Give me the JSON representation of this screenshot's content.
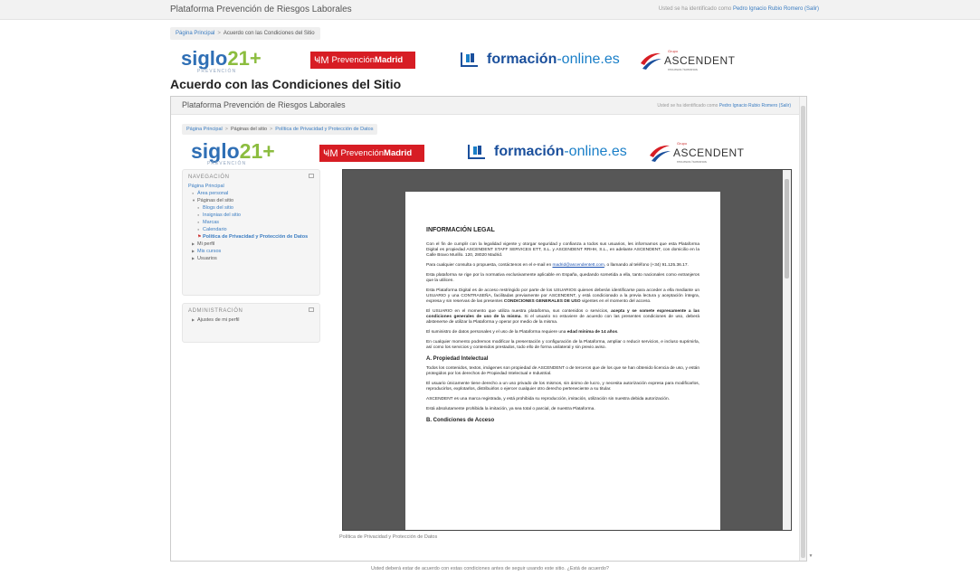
{
  "topbar": {
    "site_title": "Plataforma Prevención de Riesgos Laborales",
    "login_prefix": "Usted se ha identificado como ",
    "user_name": "Pedro Ignacio Rubio Romero",
    "logout": " (Salir)"
  },
  "breadcrumb": {
    "home": "Página Principal",
    "current": "Acuerdo con las Condiciones del Sitio"
  },
  "logos": {
    "siglo": {
      "a": "siglo",
      "b": "21",
      "plus": "+",
      "sub": "PREVENCIÓN"
    },
    "pmadrid": {
      "mark": "ҸМ",
      "a": "Prevención ",
      "b": "Madrid"
    },
    "formacion": {
      "a": "formación",
      "b": "-online.es"
    },
    "ascendent": {
      "grupo": "Grupo",
      "name": "ASCENDENT",
      "sub": "recursos humanos"
    }
  },
  "page_heading": "Acuerdo con las Condiciones del Sitio",
  "embedded": {
    "site_title": "Plataforma Prevención de Riesgos Laborales",
    "login_prefix": "Usted se ha identificado como ",
    "user_name": "Pedro Ignacio Rubio Romero",
    "logout": " (Salir)",
    "breadcrumb": {
      "home": "Página Principal",
      "pages": "Páginas del sitio",
      "current": "Política de Privacidad y Protección de Datos"
    },
    "navigation": {
      "title": "NAVEGACIÓN",
      "home": "Página Principal",
      "area_personal": "Área personal",
      "site_pages": "Páginas del sitio",
      "blogs": "Blogs del sitio",
      "badges": "Insignias del sitio",
      "tags": "Marcas",
      "calendar": "Calendario",
      "privacy": "Política de Privacidad y Protección de Datos",
      "my_profile": "Mi perfil",
      "my_courses": "Mis cursos",
      "users": "Usuarios"
    },
    "administration": {
      "title": "ADMINISTRACIÓN",
      "profile_settings": "Ajustes de mi perfil"
    },
    "caption": "Política de Privacidad y Protección de Datos"
  },
  "document": {
    "title": "INFORMACIÓN LEGAL",
    "p1": "Con el fin de cumplir con la legalidad vigente y otorgar seguridad y confianza a todos sus usuarios, les informamos que esta Plataforma Digital es propiedad ASCENDENT STAFF SERVICES ETT, S.L. y ASCENDENT RRHH, S.L., en adelante ASCENDENT, con domicilio en la Calle Bravo Murillo. 120, 28020 Madrid.",
    "p2a": "Para cualquier consulta o propuesta, contáctenos en el e-mail en ",
    "p2_email": "madrid@ascendentett.com",
    "p2b": ", o llamando al teléfono (+34) 91.125.36.17.",
    "p3": "Esta plataforma se rige por la normativa exclusivamente aplicable en España, quedando sometida a ella, tanto nacionales como extranjeros que la utilicen.",
    "p4a": "Esta Plataforma Digital es de acceso restringido por parte de los USUARIOS quienes deberán identificarse para acceder a ella mediante un USUARIO y una CONTRASEÑA, facilitadas previamente por ASCENDENT, y está condicionado a la previa lectura y aceptación íntegra, expresa y sin reservas de las presentes ",
    "p4_bold": "CONDICIONES GENERALES DE USO",
    "p4b": " vigentes en el momento del acceso.",
    "p5a": "El USUARIO en el momento que utiliza nuestra plataforma, sus contenidos o servicios, ",
    "p5_bold": "acepta y se somete expresamente a las condiciones generales de uso de la misma",
    "p5b": ". Si el usuario no estuviere de acuerdo con las presentes condiciones de uso, deberá abstenerse de utilizar la Plataforma y operar por medio de la misma.",
    "p6a": "El suministro de datos personales y el uso de la Plataforma requiere una ",
    "p6_bold": "edad mínima de 14 años",
    "p6b": ".",
    "p7": "En cualquier momento podremos modificar la presentación y configuración de la Plataforma, ampliar o reducir servicios, e incluso suprimirla, así como los servicios y contenidos prestados, todo ello de forma unilateral y sin previo aviso.",
    "section_a": "A. Propiedad Intelectual",
    "p8": "Todos los contenidos, textos, imágenes son propiedad de ASCENDENT o de terceros que de los que se han obtenido licencia de uso, y están protegidos por los derechos de Propiedad Intelectual e Industrial.",
    "p9": "El usuario únicamente tiene derecho a un uso privado de los mismos, sin ánimo de lucro, y necesita autorización expresa para modificarlos, reproducirlos, explotarlos, distribuirlos o ejercer cualquier otro derecho perteneciente a su titular.",
    "p10": "ASCENDENT es una marca registrada, y está prohibida su reproducción, imitación, utilización sin nuestra debida autorización.",
    "p11": "Está absolutamente prohibida la imitación, ya sea total o parcial, de nuestra Plataforma.",
    "section_b": "B. Condiciones de Acceso"
  },
  "bottom_note": "Usted deberá estar de acuerdo con estas condiciones antes de seguir usando este sitio. ¿Está de acuerdo?",
  "colors": {
    "link": "#3a7cc1",
    "brand_red": "#d71d24",
    "brand_green": "#8cbd3f",
    "brand_blue": "#2f6fb5"
  }
}
